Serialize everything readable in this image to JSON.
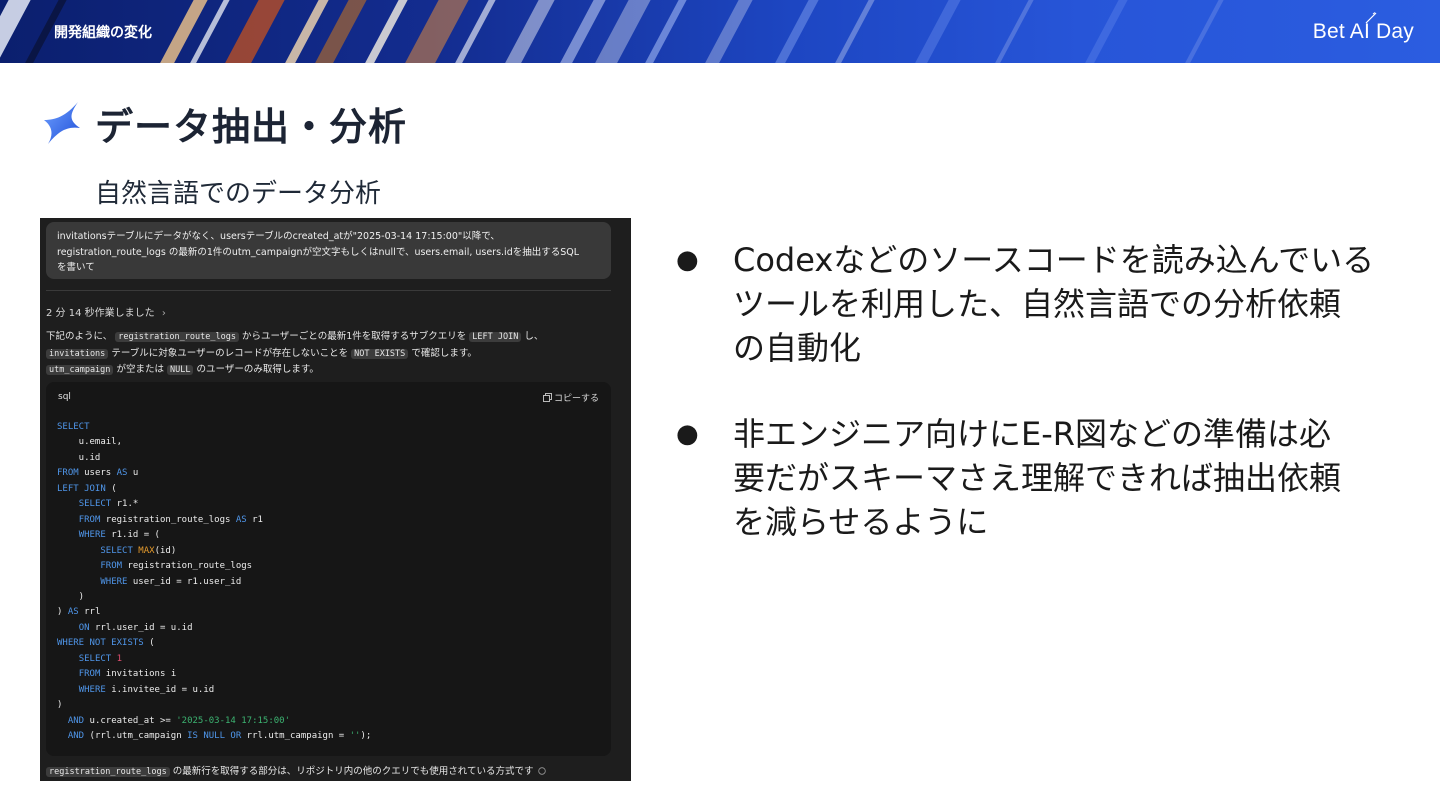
{
  "header": {
    "section_label": "開発組織の変化",
    "brand": "Bet AI Day"
  },
  "slide": {
    "title": "データ抽出・分析",
    "subtitle": "自然言語でのデータ分析"
  },
  "screenshot": {
    "prompt_lines": [
      "invitationsテーブルにデータがなく、usersテーブルのcreated_atが\"2025-03-14 17:15:00\"以降で、",
      "registration_route_logs の最新の1件のutm_campaignが空文字もしくはnullで、users.email, users.idを抽出するSQL",
      "を書いて"
    ],
    "worked_label": "2 分 14 秒作業しました",
    "worked_chevron": "›",
    "explain": {
      "l1_a": "下記のように、",
      "l1_chip1": "registration_route_logs",
      "l1_b": "からユーザーごとの最新1件を取得するサブクエリを",
      "l1_chip2": "LEFT JOIN",
      "l1_c": "し、",
      "l2_chip1": "invitations",
      "l2_a": "テーブルに対象ユーザーのレコードが存在しないことを",
      "l2_chip2": "NOT EXISTS",
      "l2_b": "で確認します。",
      "l3_chip1": "utm_campaign",
      "l3_a": "が空または",
      "l3_chip2": "NULL",
      "l3_b": "のユーザーのみ取得します。"
    },
    "code_lang": "sql",
    "copy_label": "コピーする",
    "footer": {
      "chip": "registration_route_logs",
      "text": "の最新行を取得する部分は、リポジトリ内の他のクエリでも使用されている方式です"
    }
  },
  "bullets": [
    "Codexなどのソースコードを読み込んでいるツールを利用した、自然言語での分析依頼の自動化",
    "非エンジニア向けにE-R図などの準備は必要だがスキーマさえ理解できれば抽出依頼を減らせるように"
  ],
  "bullet_lines": [
    [
      "Codexなどのソースコードを読み込んでいる",
      "ツールを利用した、自然言語での分析依頼",
      "の自動化"
    ],
    [
      "非エンジニア向けにE-R図などの準備は必",
      "要だがスキーマさえ理解できれば抽出依頼",
      "を減らせるように"
    ]
  ],
  "bullet_symbol": "●",
  "colors": {
    "banner_dark": "#0b1f6e",
    "banner_light": "#2b5de0",
    "star_blue": "#3b6ee8",
    "code_keyword": "#4f95e8",
    "code_function": "#e49a2d",
    "code_number": "#e04e6f",
    "code_string": "#3cb371"
  },
  "icons": [
    "sparkle-star-icon",
    "copy-icon",
    "chevron-right-icon",
    "info-icon"
  ]
}
